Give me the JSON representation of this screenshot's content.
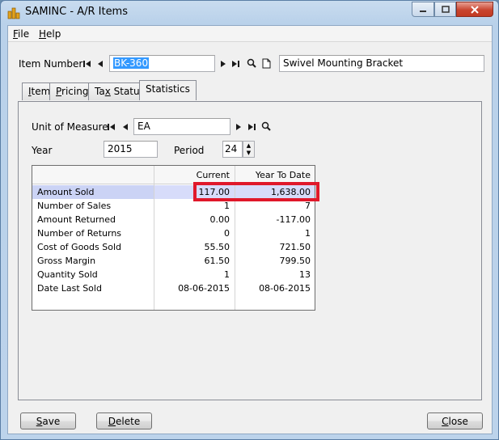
{
  "window": {
    "title": "SAMINC - A/R Items",
    "min_icon": "minimize-icon",
    "max_icon": "maximize-icon",
    "close_icon": "close-icon"
  },
  "menu": [
    {
      "acc": "F",
      "rest": "ile"
    },
    {
      "acc": "H",
      "rest": "elp"
    }
  ],
  "item": {
    "label": "Item Number",
    "value": "BK-360",
    "description": "Swivel Mounting Bracket"
  },
  "tabs": [
    {
      "acc": "I",
      "rest": "tem"
    },
    {
      "acc": "P",
      "rest": "ricing"
    },
    {
      "pre": "Ta",
      "acc": "x",
      "rest": " Status"
    },
    {
      "pre": "Statistics",
      "acc": "",
      "rest": ""
    }
  ],
  "unit": {
    "label": "Unit of Measure",
    "value": "EA"
  },
  "year": {
    "label": "Year",
    "value": "2015"
  },
  "period": {
    "label": "Period",
    "value": "24"
  },
  "grid": {
    "headers": [
      "",
      "Current",
      "Year To Date"
    ],
    "rows": [
      [
        "Amount Sold",
        "117.00",
        "1,638.00"
      ],
      [
        "Number of Sales",
        "1",
        "7"
      ],
      [
        "Amount Returned",
        "0.00",
        "-117.00"
      ],
      [
        "Number of Returns",
        "0",
        "1"
      ],
      [
        "Cost of Goods Sold",
        "55.50",
        "721.50"
      ],
      [
        "Gross Margin",
        "61.50",
        "799.50"
      ],
      [
        "Quantity Sold",
        "1",
        "13"
      ],
      [
        "Date Last Sold",
        "08-06-2015",
        "08-06-2015"
      ]
    ]
  },
  "buttons": {
    "save": {
      "acc": "S",
      "rest": "ave"
    },
    "delete": {
      "acc": "D",
      "rest": "elete"
    },
    "close": {
      "acc": "C",
      "rest": "lose"
    }
  },
  "colors": {
    "highlight": "#e0182a",
    "selection": "#3399ff",
    "row_selected": "#cbd3f5"
  }
}
